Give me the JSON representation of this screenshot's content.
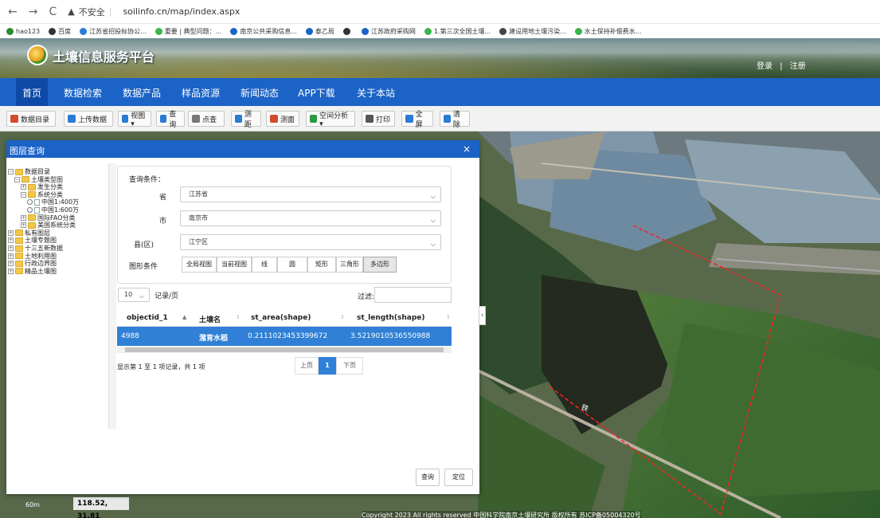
{
  "browser": {
    "security_label": "不安全",
    "url": "soilinfo.cn/map/index.aspx",
    "bookmarks": [
      {
        "label": "hao123",
        "color": "#2b8a2b"
      },
      {
        "label": "百度",
        "color": "#333333"
      },
      {
        "label": "江苏省招投标协公...",
        "color": "#2a7bd6"
      },
      {
        "label": "重要 | 典型问题：...",
        "color": "#39b54a"
      },
      {
        "label": "南京公共采购信息...",
        "color": "#1b63c7"
      },
      {
        "label": "泰乙局",
        "color": "#1b63c7"
      },
      {
        "label": "",
        "color": "#333333"
      },
      {
        "label": "江苏政府采购网",
        "color": "#1b63c7"
      },
      {
        "label": "1.第三次全国土壤...",
        "color": "#39b54a"
      },
      {
        "label": "建设用地土壤污染...",
        "color": "#444444"
      },
      {
        "label": "水土保持补偿费水...",
        "color": "#39b54a"
      }
    ]
  },
  "header": {
    "title": "土壤信息服务平台",
    "login": "登录",
    "separator": "|",
    "register": "注册"
  },
  "nav": [
    {
      "label": "首页"
    },
    {
      "label": "数据检索"
    },
    {
      "label": "数据产品"
    },
    {
      "label": "样品资源"
    },
    {
      "label": "新闻动态"
    },
    {
      "label": "APP下载"
    },
    {
      "label": "关于本站"
    }
  ],
  "toolbar": [
    {
      "label": "数据目录",
      "icon": "catalog-icon",
      "color": "#d24b2e"
    },
    {
      "label": "上传数据",
      "icon": "upload-icon",
      "color": "#2a7bd6"
    },
    {
      "label": "视图 ▾",
      "icon": "view-icon",
      "color": "#2a7bd6"
    },
    {
      "label": "查询",
      "icon": "query-icon",
      "color": "#2a7bd6"
    },
    {
      "label": "点查",
      "icon": "point-query-icon",
      "color": "#777777"
    },
    {
      "label": "测距",
      "icon": "measure-distance-icon",
      "color": "#2a7bd6"
    },
    {
      "label": "测面",
      "icon": "measure-area-icon",
      "color": "#d24b2e"
    },
    {
      "label": "空间分析 ▾",
      "icon": "spatial-analysis-icon",
      "color": "#2a9b3f"
    },
    {
      "label": "打印",
      "icon": "print-icon",
      "color": "#555555"
    },
    {
      "label": "全屏",
      "icon": "fullscreen-icon",
      "color": "#2a7bd6"
    },
    {
      "label": "清除",
      "icon": "clear-icon",
      "color": "#2a7bd6"
    }
  ],
  "dialog": {
    "title": "图层查询",
    "close": "×",
    "tree": [
      {
        "label": "数据目录",
        "pm": "⊟"
      },
      {
        "label": "土壤类型图",
        "pm": "⊟"
      },
      {
        "label": "发生分类",
        "pm": "⊞"
      },
      {
        "label": "系统分类",
        "pm": "⊟"
      },
      {
        "label": "中国1:400万",
        "radio": true
      },
      {
        "label": "中国1:600万",
        "radio": true
      },
      {
        "label": "国际FAO分类",
        "pm": "⊞"
      },
      {
        "label": "美国系统分类",
        "pm": "⊞"
      },
      {
        "label": "私有图层",
        "pm": "⊞"
      },
      {
        "label": "土壤专题图",
        "pm": "⊞"
      },
      {
        "label": "十三五新数据",
        "pm": "⊞"
      },
      {
        "label": "土地利用图",
        "pm": "⊞"
      },
      {
        "label": "行政边界图",
        "pm": "⊞"
      },
      {
        "label": "精品土壤图",
        "pm": "⊞"
      }
    ],
    "query": {
      "heading": "查询条件：",
      "province_label": "省",
      "province_value": "江苏省",
      "city_label": "市",
      "city_value": "南京市",
      "county_label": "县(区)",
      "county_value": "江宁区",
      "shape_label": "图形条件",
      "shapes": [
        "全局视图",
        "当前视图",
        "线",
        "圆",
        "矩形",
        "三角形",
        "多边形"
      ]
    },
    "table": {
      "page_size": "10",
      "page_size_suffix": "记录/页",
      "filter_label": "过滤:",
      "filter_value": "",
      "columns": [
        "objectid_1",
        "土壤名",
        "st_area(shape)",
        "st_length(shape)"
      ],
      "rows": [
        [
          "4988",
          "潴育水稻",
          "0.2111023453399672",
          "3.5219010536550988"
        ]
      ],
      "summary": "显示第 1 至 1 项记录，共 1 项",
      "prev": "上页",
      "page": "1",
      "next": "下页"
    },
    "query_button": "查询",
    "locate_button": "定位"
  },
  "map": {
    "scale": "60m",
    "coords": "118.52, 31.81",
    "road_label": "铁",
    "copyright": "Copyright 2023 All rights reserved 中国科学院南京土壤研究所 版权所有 苏ICP备05004320号"
  }
}
